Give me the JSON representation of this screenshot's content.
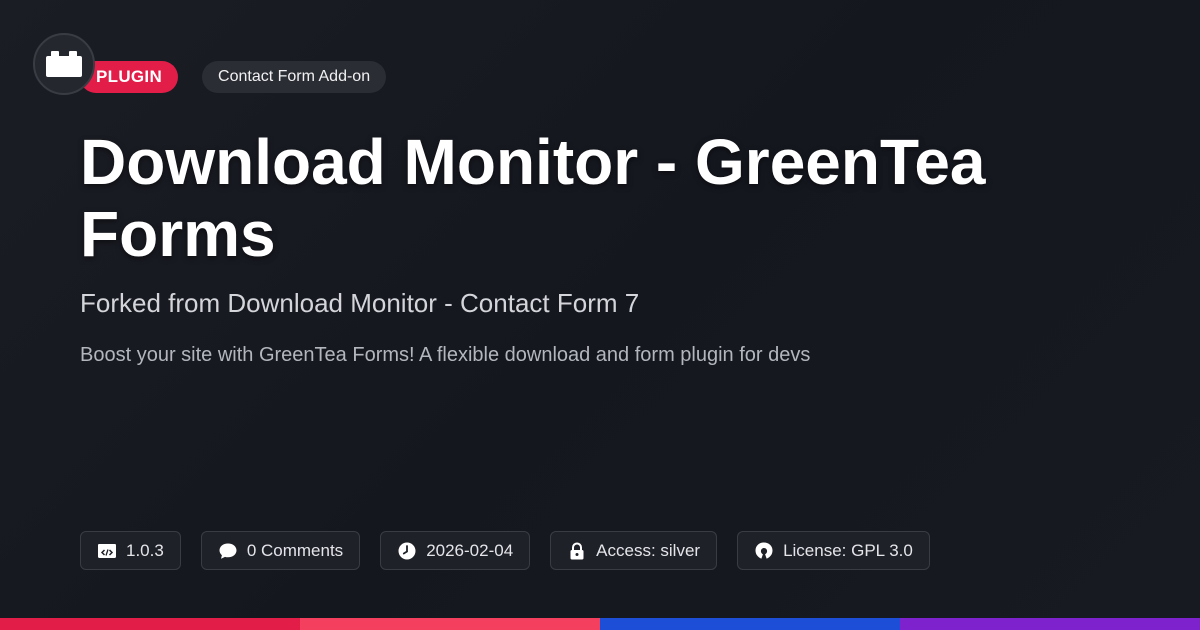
{
  "logo": {
    "icon": "plugin-block-icon"
  },
  "tags": {
    "type_label": "PLUGIN",
    "category_label": "Contact Form Add-on"
  },
  "title": "Download Monitor - GreenTea Forms",
  "subtitle": "Forked from Download Monitor - Contact Form 7",
  "description": "Boost your site with GreenTea Forms! A flexible download and form plugin for devs",
  "meta": {
    "version": "1.0.3",
    "comments": "0 Comments",
    "date": "2026-02-04",
    "access": "Access: silver",
    "license": "License: GPL 3.0"
  },
  "colors": {
    "accent": "#e11d48",
    "bar": [
      "#e11d48",
      "#f43f5e",
      "#1d4ed8",
      "#7e22ce"
    ]
  }
}
